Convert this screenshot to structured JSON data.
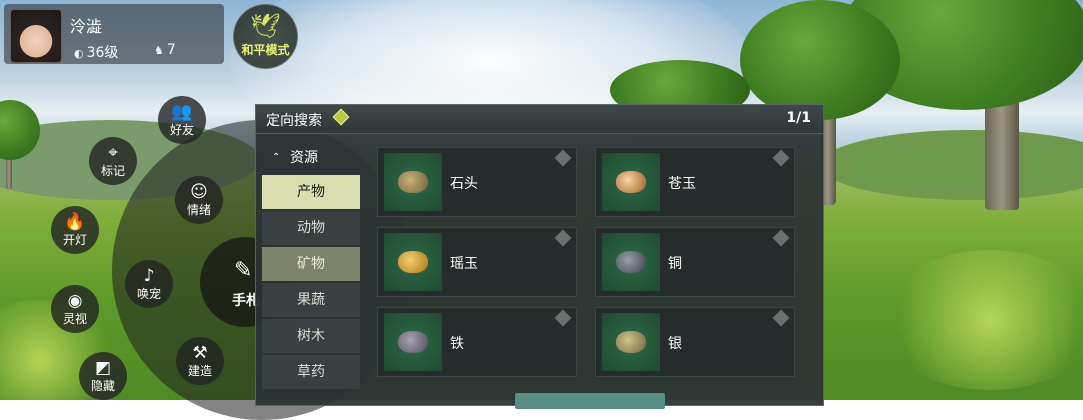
{
  "player": {
    "name": "泠澁",
    "level": "36级",
    "companions": "7"
  },
  "mode": {
    "label": "和平模式"
  },
  "radial_menu": {
    "items": [
      {
        "label": "好友",
        "icon": "friends-icon"
      },
      {
        "label": "标记",
        "icon": "map-pin-icon"
      },
      {
        "label": "情绪",
        "icon": "mask-icon"
      },
      {
        "label": "开灯",
        "icon": "torch-icon"
      },
      {
        "label": "唤宠",
        "icon": "whistle-icon"
      },
      {
        "label": "灵视",
        "icon": "camera-icon"
      },
      {
        "label": "建造",
        "icon": "hammer-icon"
      },
      {
        "label": "隐藏",
        "icon": "hide-icon"
      }
    ],
    "center_label": "手札"
  },
  "panel": {
    "title": "定向搜索",
    "page": "1/1",
    "category_header": "资源",
    "categories": [
      "产物",
      "动物",
      "矿物",
      "果蔬",
      "树木",
      "草药"
    ],
    "active_category": "产物",
    "items": [
      {
        "label": "石头",
        "icon": "stone-icon"
      },
      {
        "label": "苍玉",
        "icon": "jade-icon"
      },
      {
        "label": "瑶玉",
        "icon": "gold-jade-icon"
      },
      {
        "label": "铜",
        "icon": "copper-ore-icon"
      },
      {
        "label": "铁",
        "icon": "iron-ore-icon"
      },
      {
        "label": "银",
        "icon": "silver-ore-icon"
      }
    ]
  },
  "colors": {
    "accent": "#d9deb0",
    "mode_text": "#e8f07a",
    "panel_bg": "#2d3234"
  }
}
